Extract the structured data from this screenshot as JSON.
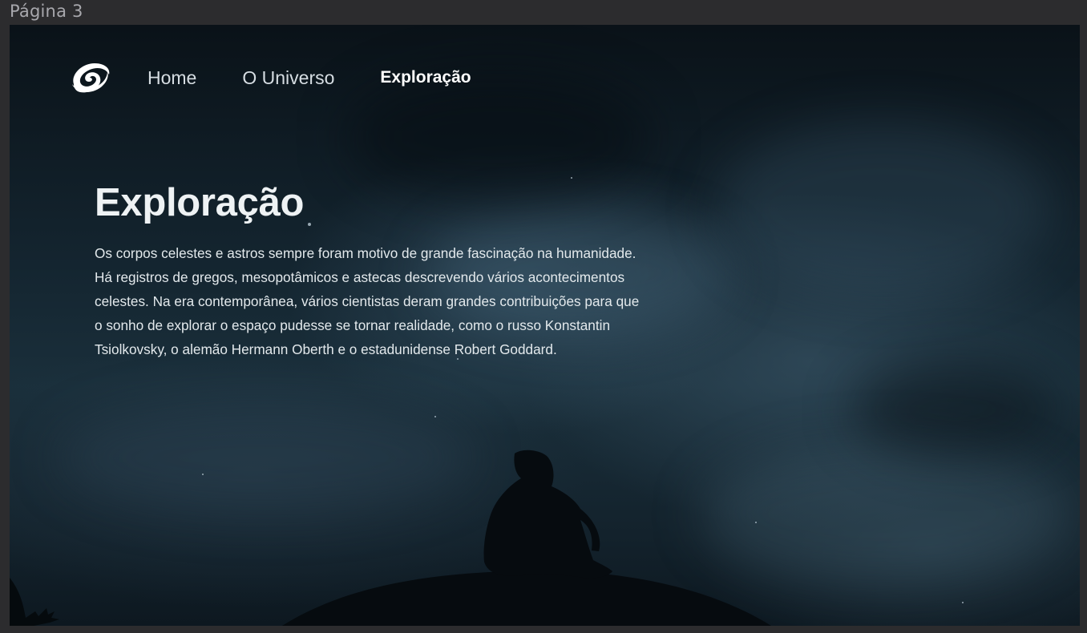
{
  "frame": {
    "label": "Página 3"
  },
  "nav": {
    "logo_icon": "spiral-galaxy-icon",
    "links": [
      {
        "label": "Home",
        "active": false
      },
      {
        "label": "O Universo",
        "active": false
      },
      {
        "label": "Exploração",
        "active": true
      }
    ]
  },
  "hero": {
    "title": "Exploração",
    "paragraph": "Os corpos celestes e astros sempre foram motivo de grande fascinação na humanidade. Há registros de gregos, mesopotâmicos e astecas descrevendo vários acontecimentos celestes. Na era contemporânea, vários cientistas deram grandes contribuições para que o sonho de explorar o espaço pudesse se tornar realidade, como o russo Konstantin Tsiolkovsky, o alemão Hermann Oberth e o estadunidense Robert Goddard."
  },
  "colors": {
    "frame_background": "#2c2c2e",
    "sky_dark": "#0a1218",
    "sky_mid": "#1a2f3b",
    "text_primary": "#ffffff"
  }
}
